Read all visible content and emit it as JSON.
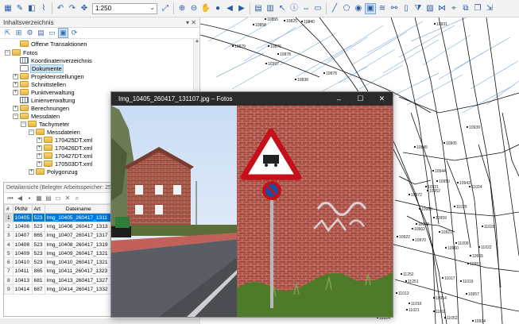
{
  "toolbar": {
    "scale_value": "1:250",
    "icons_left": [
      "layout-icon",
      "edit-icon",
      "layer-icon",
      "brush-icon",
      "undo-icon",
      "redo-icon",
      "move-icon"
    ],
    "icons_right": [
      "zoom-in-icon",
      "zoom-out-icon",
      "pan-icon",
      "globe-icon",
      "back-icon",
      "forward-icon",
      "table-icon",
      "select-icon",
      "info-icon",
      "measure-icon",
      "ruler-icon"
    ]
  },
  "panel": {
    "title": "Inhaltsverzeichnis",
    "pin": "▾ ✕"
  },
  "tree": [
    {
      "label": "Offene Transaktionen",
      "level": 1,
      "expander": "",
      "icon": "folder"
    },
    {
      "label": "Fotos",
      "level": 0,
      "expander": "−",
      "icon": "folder"
    },
    {
      "label": "Koordinatenverzeichnis",
      "level": 1,
      "expander": "",
      "icon": "grid"
    },
    {
      "label": "Dokumente",
      "level": 1,
      "expander": "",
      "icon": "doc",
      "highlight": true
    },
    {
      "label": "Projekteinstellungen",
      "level": 1,
      "expander": "+",
      "icon": "folder"
    },
    {
      "label": "Schnittstellen",
      "level": 1,
      "expander": "+",
      "icon": "folder"
    },
    {
      "label": "Punktverwaltung",
      "level": 1,
      "expander": "+",
      "icon": "folder"
    },
    {
      "label": "Linienverwaltung",
      "level": 1,
      "expander": "",
      "icon": "grid"
    },
    {
      "label": "Berechnungen",
      "level": 1,
      "expander": "+",
      "icon": "folder"
    },
    {
      "label": "Messdaten",
      "level": 1,
      "expander": "−",
      "icon": "folder"
    },
    {
      "label": "Tachymeter",
      "level": 2,
      "expander": "−",
      "icon": "folder"
    },
    {
      "label": "Messdateien",
      "level": 3,
      "expander": "−",
      "icon": "folder"
    },
    {
      "label": "170425DT.xml",
      "level": 4,
      "expander": "+",
      "icon": "folder"
    },
    {
      "label": "170426DT.xml",
      "level": 4,
      "expander": "+",
      "icon": "folder"
    },
    {
      "label": "170427DT.xml",
      "level": 4,
      "expander": "+",
      "icon": "folder"
    },
    {
      "label": "170503DT.xml",
      "level": 4,
      "expander": "+",
      "icon": "folder"
    },
    {
      "label": "Polygonzug",
      "level": 3,
      "expander": "+",
      "icon": "folder"
    }
  ],
  "detail": {
    "title": "Detailansicht (Belegter Arbeitsspeicher: 25",
    "columns": [
      "#",
      "PktNr",
      "Art",
      "Dateiname"
    ],
    "rows": [
      [
        "1",
        "10405",
        "523",
        "Img_10405_260417_1311"
      ],
      [
        "2",
        "10406",
        "523",
        "Img_10406_260417_1313"
      ],
      [
        "3",
        "10407",
        "865",
        "Img_10407_260417_1317"
      ],
      [
        "4",
        "10408",
        "523",
        "Img_10408_260417_1319"
      ],
      [
        "5",
        "10409",
        "523",
        "Img_10409_260417_1321"
      ],
      [
        "6",
        "10410",
        "523",
        "Img_10410_260417_1321"
      ],
      [
        "7",
        "10411",
        "865",
        "Img_10411_260417_1323"
      ],
      [
        "8",
        "10413",
        "681",
        "Img_10413_260417_1327"
      ],
      [
        "9",
        "10414",
        "687",
        "Img_10414_260417_1332"
      ]
    ],
    "selected_row": 0
  },
  "photo_window": {
    "title": "Img_10405_260417_131107.jpg – Fotos",
    "minimize": "–",
    "maximize": "☐",
    "close": "✕"
  },
  "map": {
    "point_labels": [
      "10879",
      "10858",
      "10855",
      "10825",
      "10840",
      "10876",
      "10878",
      "10397",
      "10838",
      "10878",
      "10931",
      "10939",
      "10905",
      "10845",
      "10944",
      "10950",
      "10952",
      "10943",
      "11024",
      "10921",
      "10972",
      "10965",
      "10959",
      "11029",
      "10968",
      "10970",
      "10922",
      "10962",
      "10921",
      "10960",
      "11028",
      "11006",
      "11022",
      "10965",
      "10957",
      "11252",
      "11251",
      "11017",
      "11019",
      "10957",
      "11013",
      "11016",
      "10914",
      "11021",
      "11011",
      "11052",
      "10924",
      "10914"
    ]
  }
}
